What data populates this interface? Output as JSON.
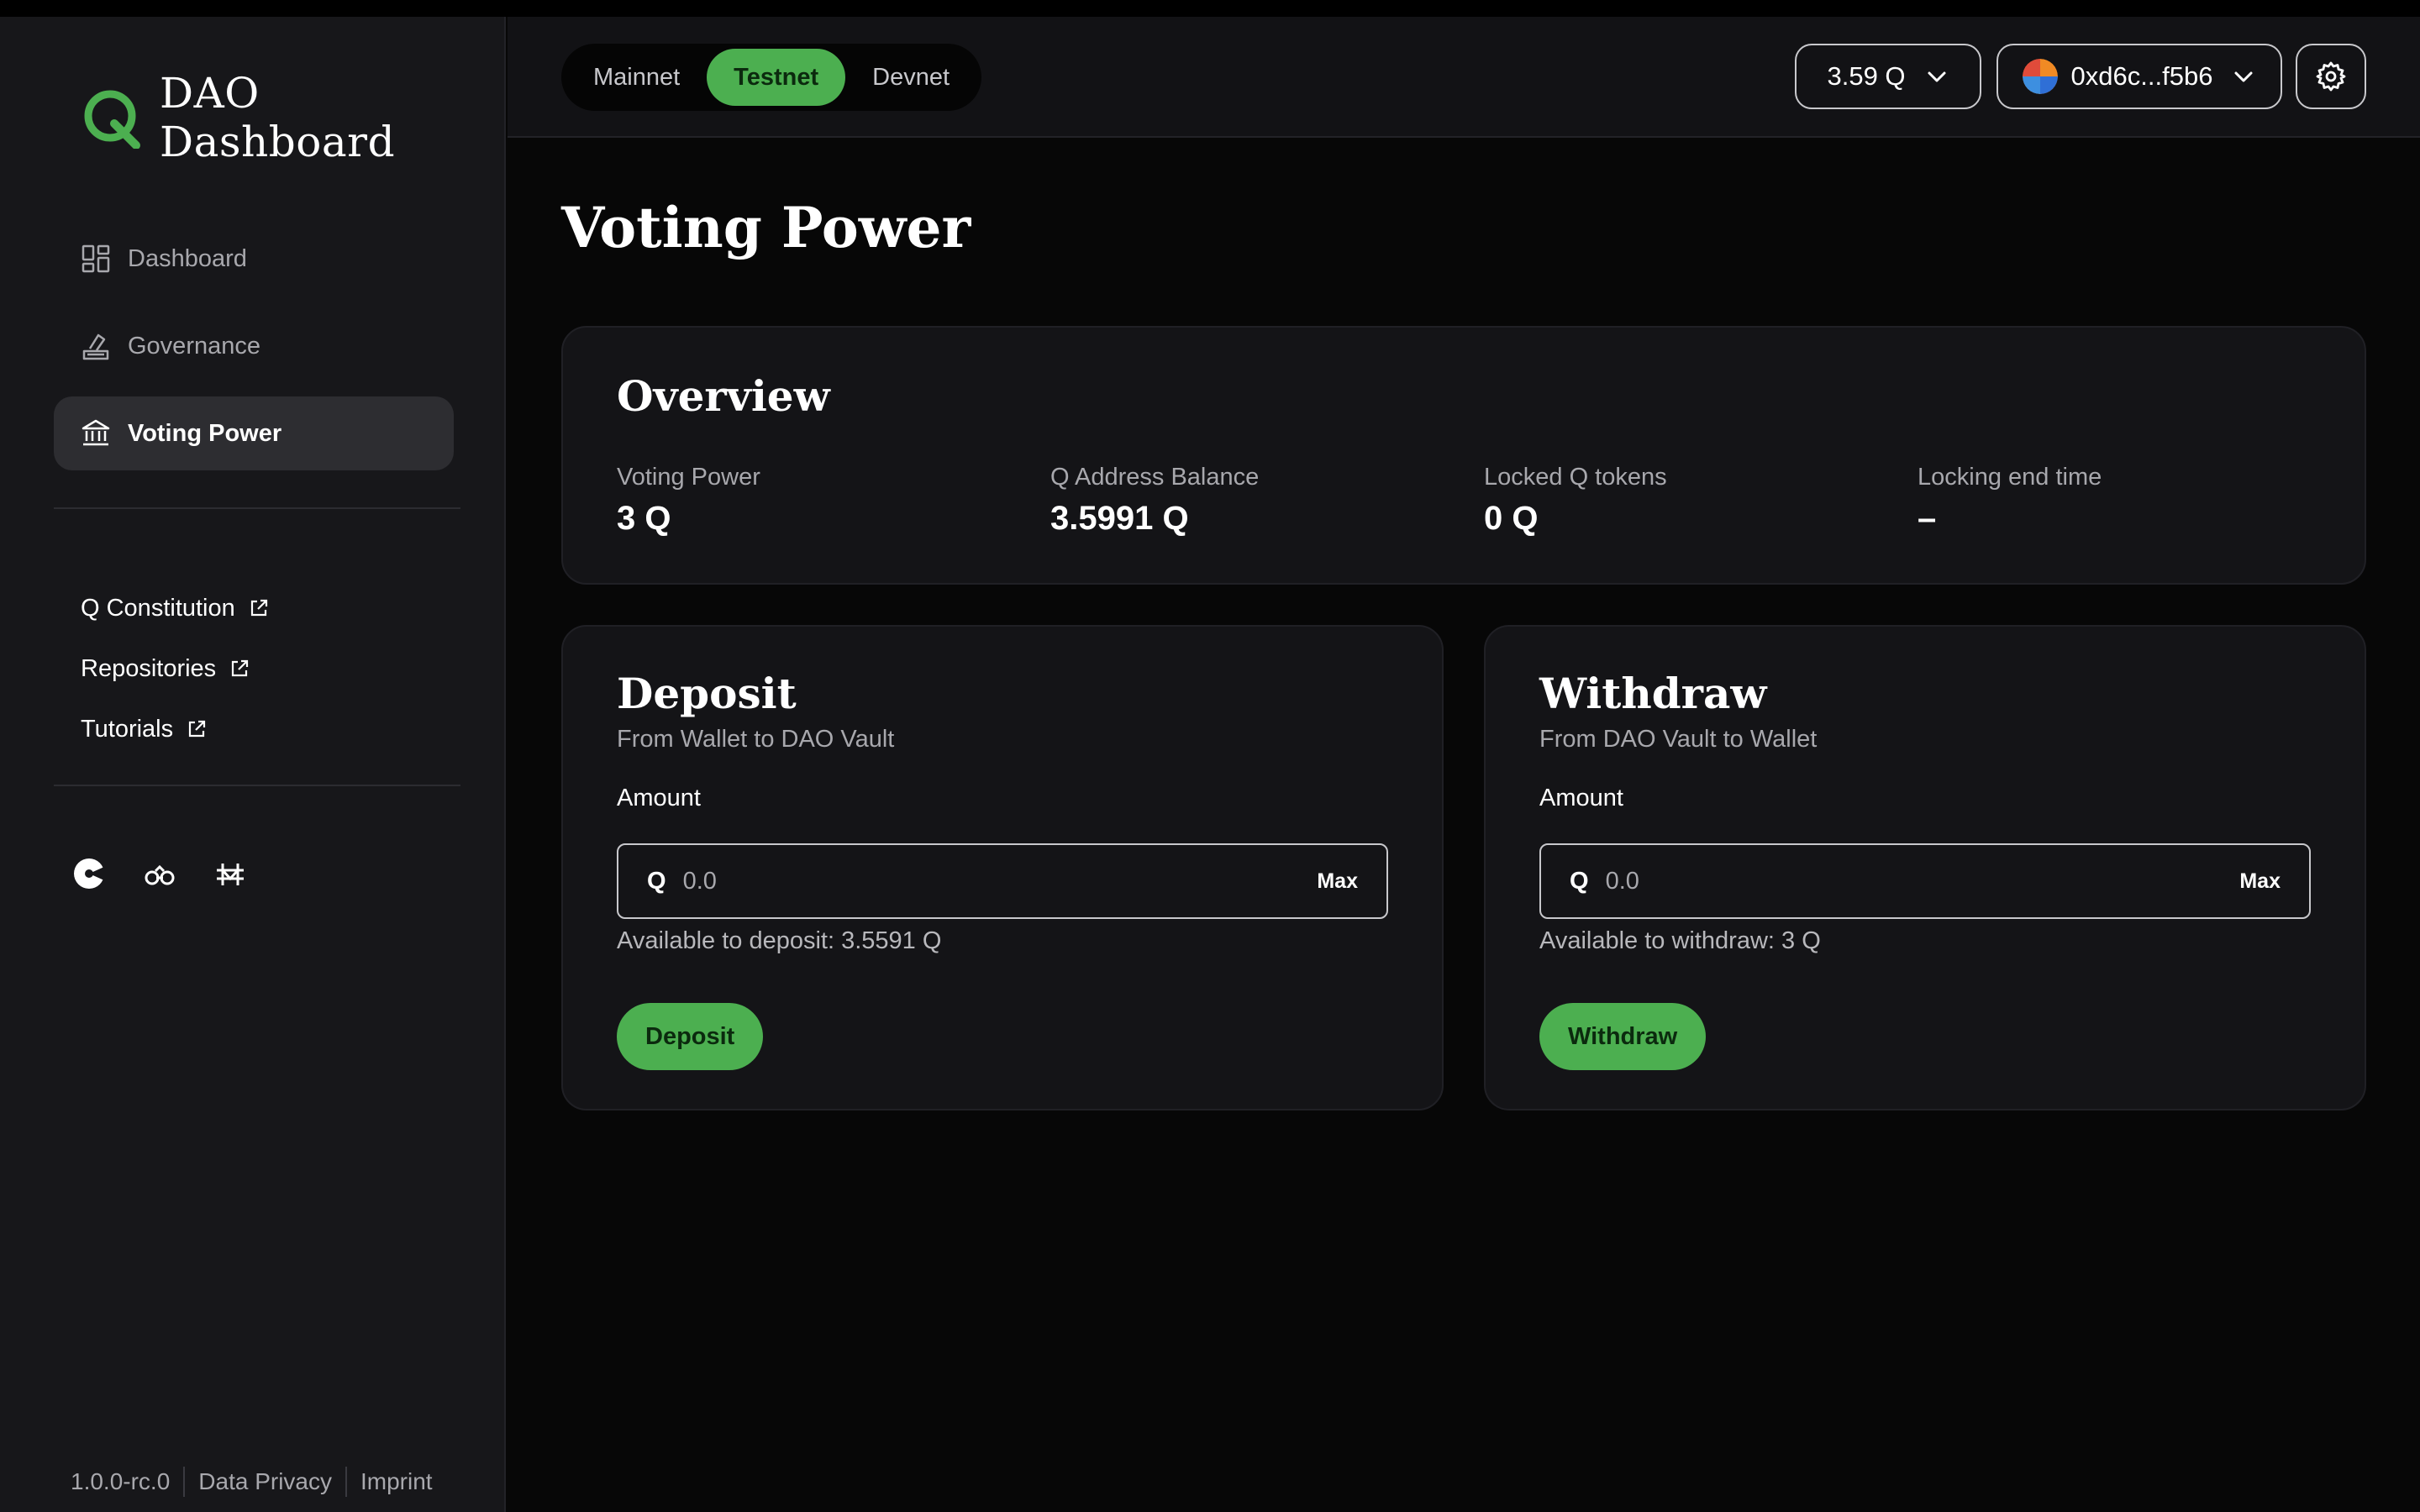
{
  "app": {
    "title": "DAO Dashboard",
    "logo_icon": "q-logo-icon"
  },
  "sidebar": {
    "nav": [
      {
        "label": "Dashboard",
        "icon": "dashboard-grid-icon",
        "active": false
      },
      {
        "label": "Governance",
        "icon": "ballot-vote-icon",
        "active": false
      },
      {
        "label": "Voting Power",
        "icon": "bank-building-icon",
        "active": true
      }
    ],
    "links": [
      {
        "label": "Q Constitution",
        "icon": "external-link-icon"
      },
      {
        "label": "Repositories",
        "icon": "external-link-icon"
      },
      {
        "label": "Tutorials",
        "icon": "external-link-icon"
      }
    ],
    "social": [
      "pacman-icon",
      "binoculars-icon",
      "bridge-icon"
    ],
    "footer": {
      "version": "1.0.0-rc.0",
      "privacy": "Data Privacy",
      "imprint": "Imprint"
    }
  },
  "header": {
    "networks": [
      {
        "label": "Mainnet",
        "active": false
      },
      {
        "label": "Testnet",
        "active": true
      },
      {
        "label": "Devnet",
        "active": false
      }
    ],
    "balance": "3.59 Q",
    "wallet": "0xd6c...f5b6",
    "settings_icon": "gear-icon"
  },
  "page": {
    "title": "Voting Power"
  },
  "overview": {
    "title": "Overview",
    "stats": [
      {
        "label": "Voting Power",
        "value": "3 Q"
      },
      {
        "label": "Q Address Balance",
        "value": "3.5991 Q"
      },
      {
        "label": "Locked Q tokens",
        "value": "0 Q"
      },
      {
        "label": "Locking end time",
        "value": "–"
      }
    ]
  },
  "deposit": {
    "title": "Deposit",
    "subtitle": "From Wallet to DAO Vault",
    "amount_label": "Amount",
    "prefix": "Q",
    "placeholder": "0.0",
    "max_label": "Max",
    "available": "Available to deposit: 3.5591 Q",
    "button": "Deposit"
  },
  "withdraw": {
    "title": "Withdraw",
    "subtitle": "From DAO Vault to Wallet",
    "amount_label": "Amount",
    "prefix": "Q",
    "placeholder": "0.0",
    "max_label": "Max",
    "available": "Available to withdraw: 3 Q",
    "button": "Withdraw"
  },
  "colors": {
    "accent": "#4caf50",
    "background": "#070707",
    "sidebar": "#17171a",
    "card": "#141417"
  }
}
